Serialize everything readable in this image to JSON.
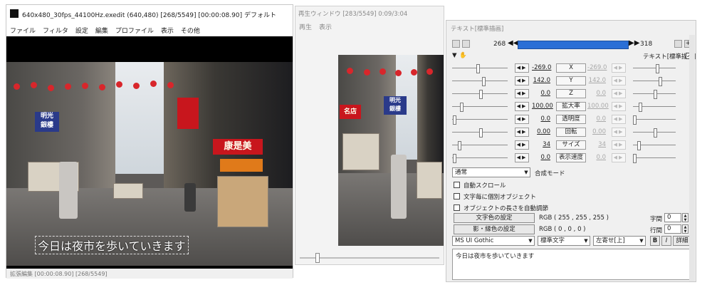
{
  "main_window": {
    "title": "640x480_30fps_44100Hz.exedit (640,480)  [268/5549]  [00:00:08.90]  デフォルト",
    "menu": [
      "ファイル",
      "フィルタ",
      "設定",
      "編集",
      "プロファイル",
      "表示",
      "その他"
    ],
    "preview_signs": {
      "bank": "明光\n銀樓",
      "big_sign": "康是美"
    },
    "subtitle": "今日は夜市を歩いていきます",
    "status": "拡張編集 [00:00:08.90] [268/5549]"
  },
  "playback_window": {
    "title": "再生ウィンドウ [283/5549]  0:09/3:04",
    "menu": [
      "再生",
      "表示"
    ],
    "preview_signs": {
      "left": "名店",
      "bank": "明光\n銀樓"
    }
  },
  "text_panel": {
    "title": "テキスト[標準描画]",
    "frame_start": "268",
    "frame_end": "318",
    "object_label": "テキスト[標準描画]",
    "object_checked": true,
    "params": [
      {
        "name": "X",
        "left": "-269.0",
        "right": "-269.0",
        "left_pos": 0.45,
        "right_pos": 0.55
      },
      {
        "name": "Y",
        "left": "142.0",
        "right": "142.0",
        "left_pos": 0.55,
        "right_pos": 0.62
      },
      {
        "name": "Z",
        "left": "0.0",
        "right": "0.0",
        "left_pos": 0.5,
        "right_pos": 0.5
      },
      {
        "name": "拡大率",
        "left": "100.00",
        "right": "100.00",
        "left_pos": 0.15,
        "right_pos": 0.15
      },
      {
        "name": "透明度",
        "left": "0.0",
        "right": "0.0",
        "left_pos": 0.02,
        "right_pos": 0.02
      },
      {
        "name": "回転",
        "left": "0.00",
        "right": "0.00",
        "left_pos": 0.5,
        "right_pos": 0.5
      },
      {
        "name": "サイズ",
        "left": "34",
        "right": "34",
        "left_pos": 0.12,
        "right_pos": 0.12
      },
      {
        "name": "表示速度",
        "left": "0.0",
        "right": "0.0",
        "left_pos": 0.02,
        "right_pos": 0.02
      }
    ],
    "blend_mode_value": "通常",
    "blend_mode_label": "合成モード",
    "options": [
      {
        "label": "自動スクロール",
        "checked": false
      },
      {
        "label": "文字毎に個別オブジェクト",
        "checked": false
      },
      {
        "label": "オブジェクトの長さを自動調節",
        "checked": false
      }
    ],
    "text_color_button": "文字色の設定",
    "text_color_value": "RGB ( 255 , 255 , 255 )",
    "shadow_color_button": "影・縁色の設定",
    "shadow_color_value": "RGB ( 0 , 0 , 0 )",
    "char_spacing_label": "字間",
    "char_spacing_value": "0",
    "line_spacing_label": "行間",
    "line_spacing_value": "0",
    "font": "MS UI Gothic",
    "style": "標準文字",
    "align": "左寄せ[上]",
    "bold_label": "B",
    "italic_label": "I",
    "detail_label": "詳細",
    "text_content": "今日は夜市を歩いていきます"
  }
}
